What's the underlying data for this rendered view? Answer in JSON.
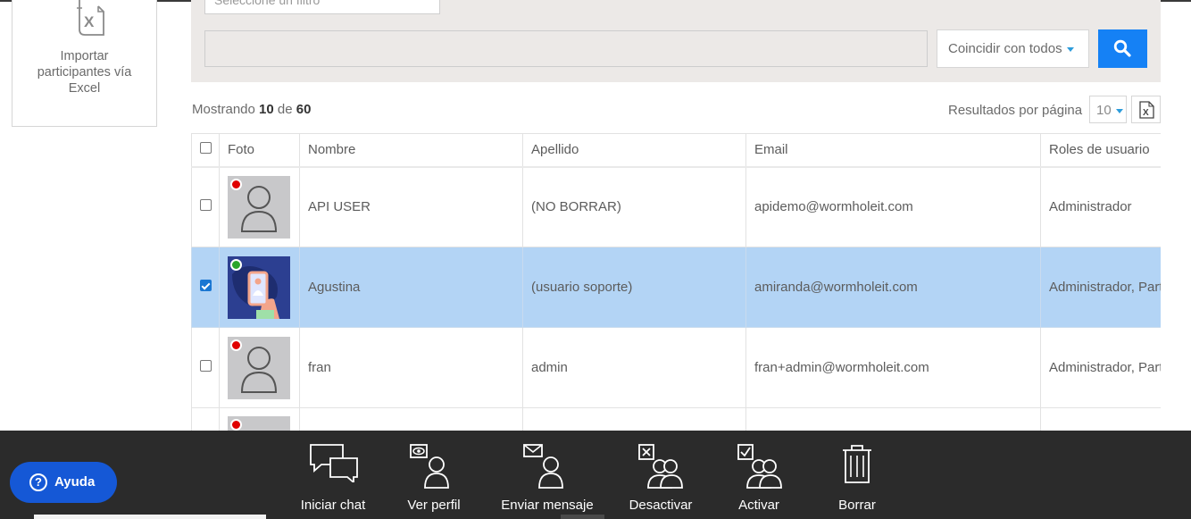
{
  "import_card": {
    "label": "Importar participantes vía Excel",
    "icon": "excel-file-icon"
  },
  "filters": {
    "filter_placeholder": "Seleccione un filtro",
    "search_value": "",
    "match_select": "Coincidir con todos",
    "search_icon": "search-icon"
  },
  "results": {
    "showing_prefix": "Mostrando",
    "showing_count": "10",
    "showing_of": "de",
    "showing_total": "60",
    "per_page_label": "Resultados por página",
    "per_page_value": "10",
    "export_icon": "excel-export-icon"
  },
  "table": {
    "headers": [
      "Foto",
      "Nombre",
      "Apellido",
      "Email",
      "Roles de usuario"
    ],
    "rows": [
      {
        "nombre": "API USER",
        "apellido": "(NO BORRAR)",
        "email": "apidemo@wormholeit.com",
        "roles": "Administrador",
        "status": "offline",
        "selected": false
      },
      {
        "nombre": "Agustina",
        "apellido": "(usuario soporte)",
        "email": "amiranda@wormholeit.com",
        "roles": "Administrador, Participante",
        "status": "online",
        "selected": true
      },
      {
        "nombre": "fran",
        "apellido": "admin",
        "email": "fran+admin@wormholeit.com",
        "roles": "Administrador, Participante",
        "status": "offline",
        "selected": false
      }
    ]
  },
  "toolbar": {
    "start_chat": "Iniciar chat",
    "view_profile": "Ver perfil",
    "send_message": "Enviar mensaje",
    "deactivate": "Desactivar",
    "activate": "Activar",
    "delete": "Borrar"
  },
  "help": {
    "label": "Ayuda"
  },
  "colors": {
    "primary": "#1581f5",
    "selected_row": "#b3d4f5",
    "toolbar_bg": "#2b2b2b",
    "help_bg": "#1558d6",
    "online": "#2aa52a",
    "offline": "#e00000"
  }
}
